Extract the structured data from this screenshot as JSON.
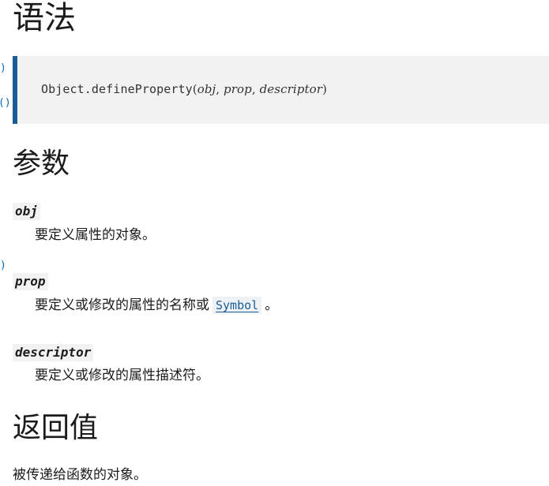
{
  "left_clip": {
    "marks": [
      ")",
      "()",
      ")"
    ]
  },
  "syntax": {
    "heading": "语法",
    "code": {
      "fn": "Object.defineProperty",
      "open": "(",
      "p1": "obj",
      "sep1": ", ",
      "p2": "prop",
      "sep2": ", ",
      "p3": "descriptor",
      "close": ")"
    }
  },
  "params": {
    "heading": "参数",
    "items": [
      {
        "term": "obj",
        "desc": "要定义属性的对象。"
      },
      {
        "term": "prop",
        "desc_before": "要定义或修改的属性的名称或",
        "link": "Symbol",
        "desc_after": "。"
      },
      {
        "term": "descriptor",
        "desc": "要定义或修改的属性描述符。"
      }
    ]
  },
  "return_value": {
    "heading": "返回值",
    "text": "被传递给函数的对象。"
  },
  "colors": {
    "accent": "#1a5c95",
    "code_bg": "#f2f2f2",
    "link": "#1a5c95"
  }
}
